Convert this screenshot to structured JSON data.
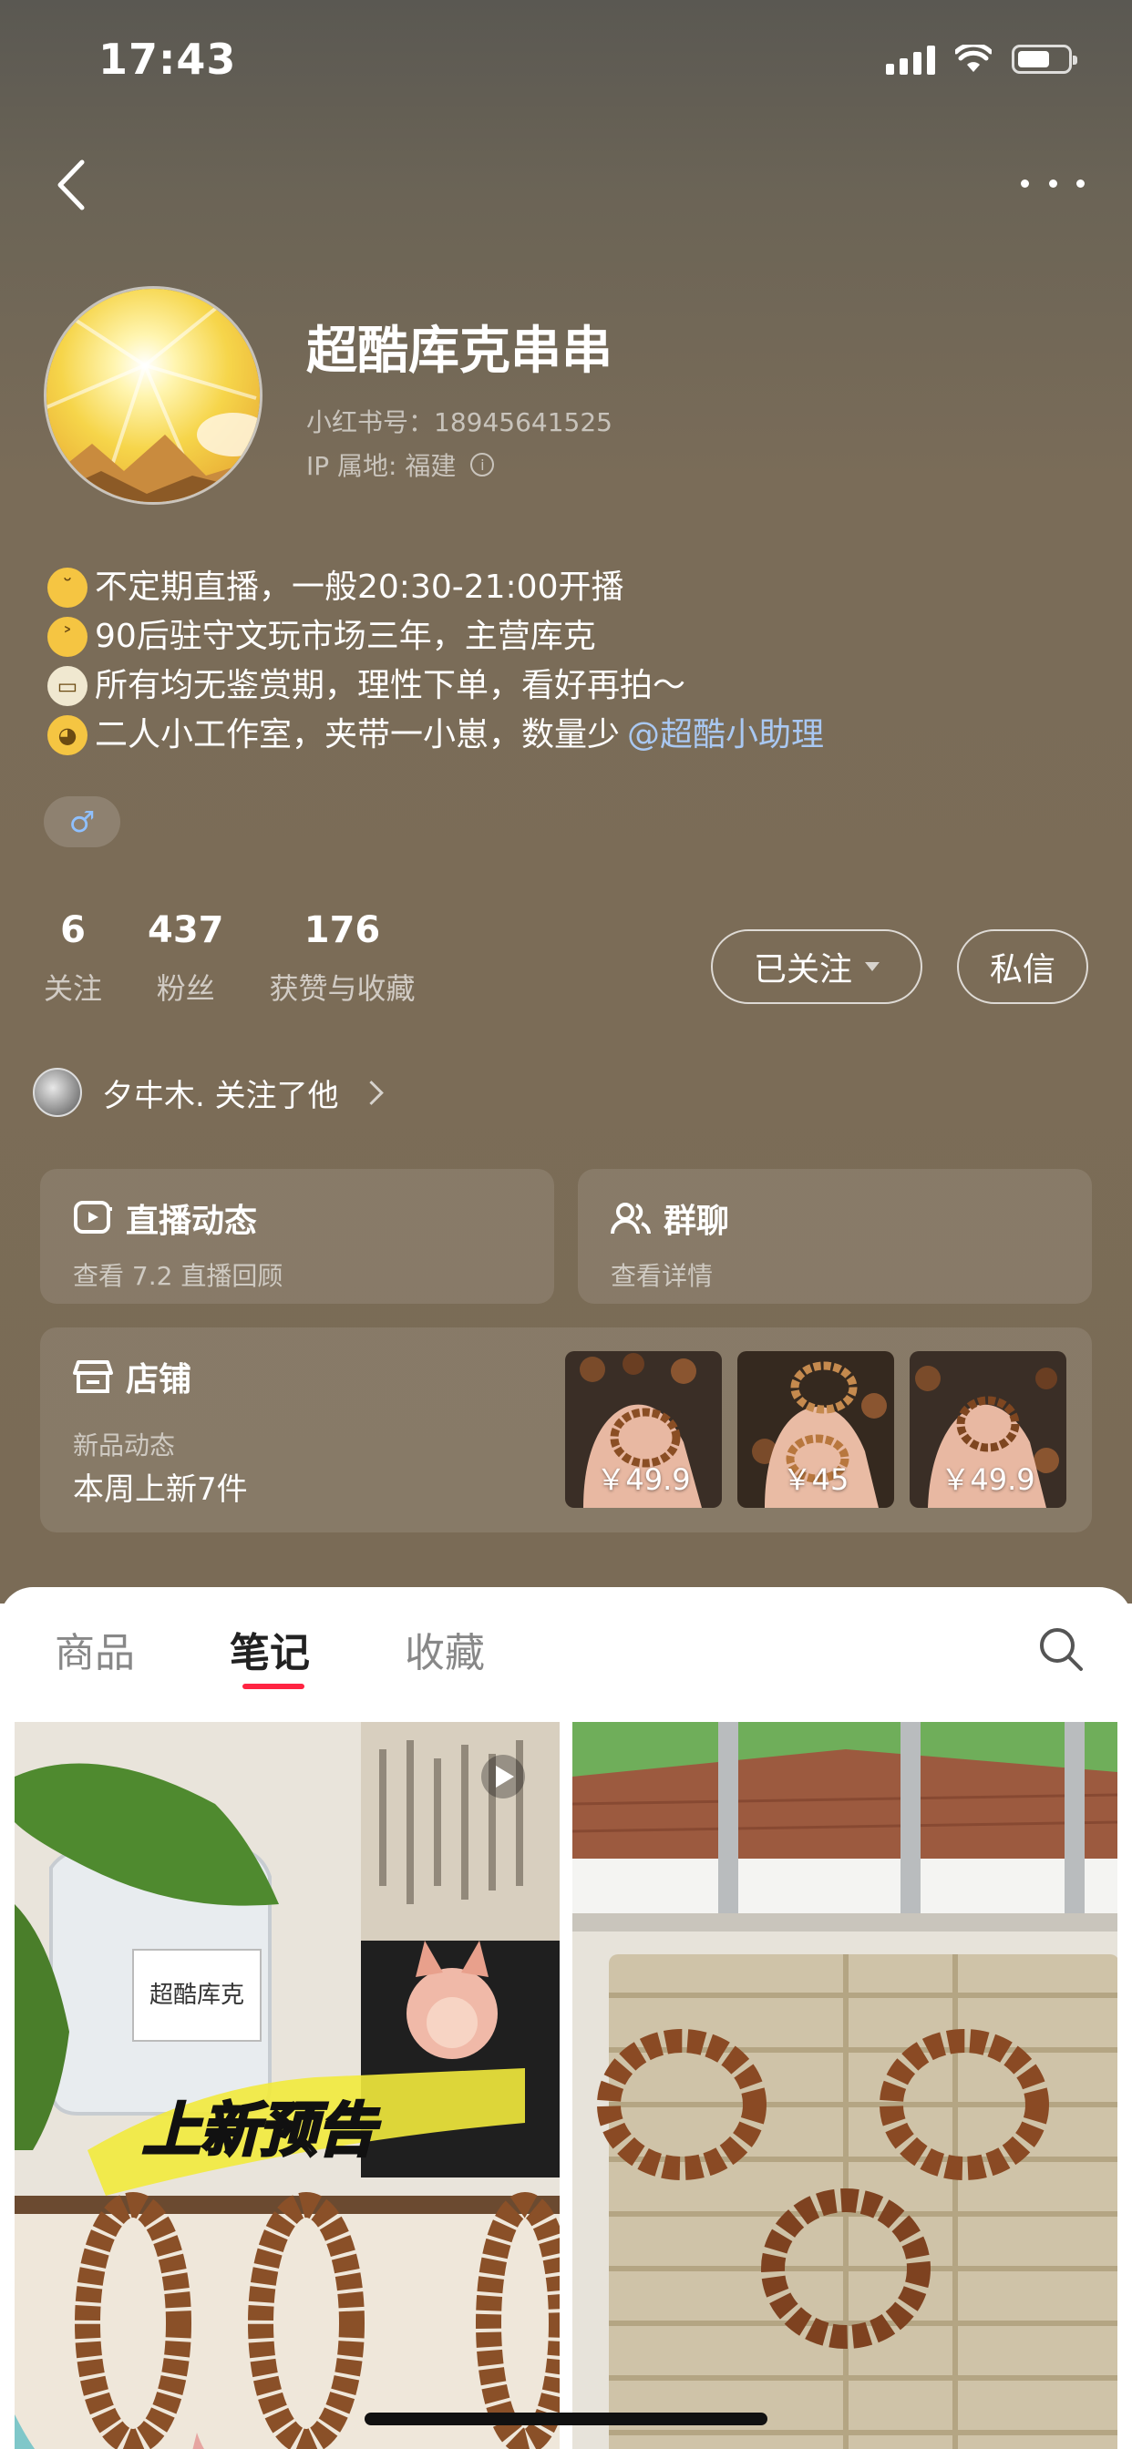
{
  "status_bar": {
    "time": "17:43"
  },
  "profile": {
    "name": "超酷库克串串",
    "red_id": "小红书号：18945641525",
    "ip": "IP 属地: 福建",
    "bio": [
      {
        "emoji": "smirk-emoji",
        "text": "不定期直播，一般20:30-21:00开播"
      },
      {
        "emoji": "grin-emoji",
        "text": "90后驻守文玩市场三年，主营库克"
      },
      {
        "emoji": "face-mask-emoji",
        "text": "所有均无鉴赏期，理性下单，看好再拍～"
      },
      {
        "emoji": "pleading-emoji",
        "text": "二人小工作室，夹带一小崽，数量少"
      }
    ],
    "bio_mention": "@超酷小助理",
    "gender_symbol": "♂"
  },
  "stats": [
    {
      "num": "6",
      "label": "关注"
    },
    {
      "num": "437",
      "label": "粉丝"
    },
    {
      "num": "176",
      "label": "获赞与收藏"
    }
  ],
  "buttons": {
    "follow": "已关注",
    "message": "私信"
  },
  "followed_by": "夕㐄木. 关注了他",
  "cards": {
    "live": {
      "title": "直播动态",
      "sub": "查看 7.2 直播回顾"
    },
    "group": {
      "title": "群聊",
      "sub": "查看详情"
    },
    "shop": {
      "title": "店铺",
      "sub1": "新品动态",
      "sub2": "本周上新7件",
      "prices": [
        "￥49.9",
        "￥45",
        "￥49.9"
      ]
    }
  },
  "tabs": [
    "商品",
    "笔记",
    "收藏"
  ],
  "notes": [
    {
      "overlay_text": "上新预告",
      "jar_label": "超酷库克"
    }
  ],
  "colors": {
    "accent": "#ff2442",
    "mention": "#a9c8f2"
  }
}
